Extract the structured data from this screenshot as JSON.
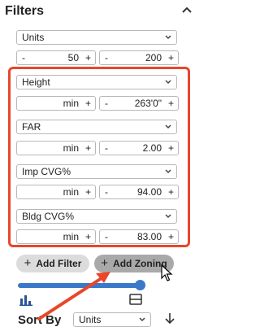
{
  "header": {
    "title": "Filters"
  },
  "units_filter": {
    "select": "Units",
    "min_minus": "-",
    "min_value": "50",
    "min_plus": "+",
    "max_minus": "-",
    "max_value": "200",
    "max_plus": "+"
  },
  "zoning_filters": [
    {
      "select": "Height",
      "min_value": "min",
      "max_value": "263'0\""
    },
    {
      "select": "FAR",
      "min_value": "min",
      "max_value": "2.00"
    },
    {
      "select": "Imp CVG%",
      "min_value": "min",
      "max_value": "94.00"
    },
    {
      "select": "Bldg CVG%",
      "min_value": "min",
      "max_value": "83.00"
    }
  ],
  "symbols": {
    "plus": "+",
    "minus": "-"
  },
  "buttons": {
    "add_filter": "Add Filter",
    "add_zoning": "Add Zoning"
  },
  "slider": {
    "value_fraction": 1.0
  },
  "sort": {
    "label": "Sort By",
    "value": "Units"
  },
  "colors": {
    "highlight": "#e8472a",
    "accent": "#3a78c9"
  },
  "icons": [
    "chevron-up-icon",
    "chevron-down-icon",
    "bar-chart-icon",
    "table-icon",
    "arrow-down-icon",
    "cursor-icon"
  ]
}
